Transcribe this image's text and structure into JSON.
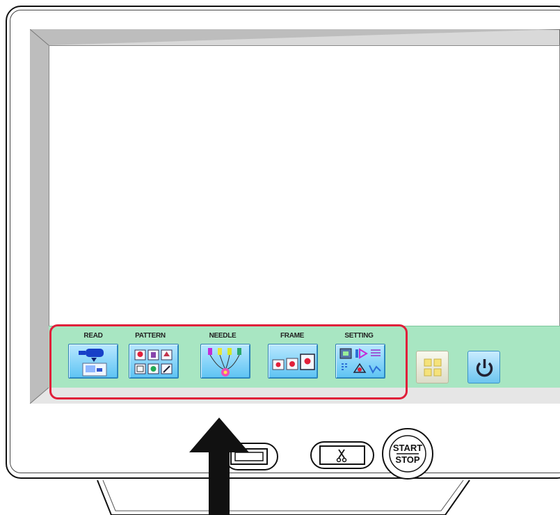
{
  "menu": {
    "items": [
      {
        "label": "READ",
        "icon": "read-icon"
      },
      {
        "label": "PATTERN",
        "icon": "pattern-icon"
      },
      {
        "label": "NEEDLE",
        "icon": "needle-icon"
      },
      {
        "label": "FRAME",
        "icon": "frame-icon"
      },
      {
        "label": "SETTING",
        "icon": "setting-icon"
      }
    ],
    "side_buttons": [
      {
        "icon": "layout-icon"
      },
      {
        "icon": "power-icon"
      }
    ]
  },
  "physical_buttons": {
    "start_line1": "START",
    "start_line2": "STOP",
    "cut_icon": "scissors-icon"
  },
  "colors": {
    "menu_bar": "#a8e6c2",
    "highlight": "#e01e3a",
    "button_blue": "#5dc3f3"
  }
}
